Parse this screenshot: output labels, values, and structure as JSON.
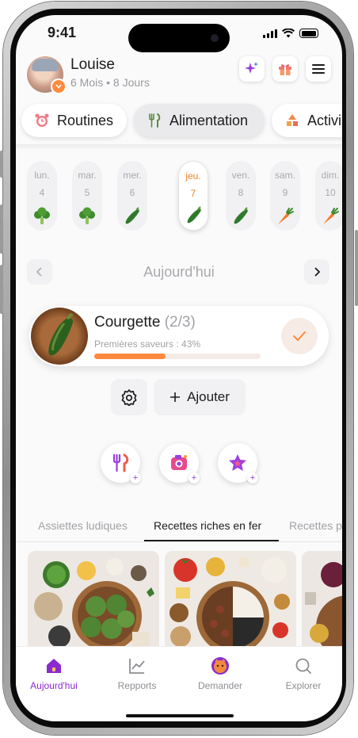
{
  "status": {
    "time": "9:41"
  },
  "profile": {
    "name": "Louise",
    "age": "6 Mois • 8 Jours"
  },
  "header_icons": [
    "sparkles-icon",
    "gift-icon",
    "menu-icon"
  ],
  "tabs": [
    {
      "label": "Routines",
      "icon": "alarm-clock-icon"
    },
    {
      "label": "Alimentation",
      "icon": "fork-knife-icon",
      "active": true
    },
    {
      "label": "Activi",
      "icon": "shapes-icon"
    }
  ],
  "days": [
    {
      "name": "lun.",
      "num": "4",
      "veg": "broccoli"
    },
    {
      "name": "mar.",
      "num": "5",
      "veg": "broccoli"
    },
    {
      "name": "mer.",
      "num": "6",
      "veg": "zucchini"
    },
    {
      "name": "jeu.",
      "num": "7",
      "veg": "zucchini",
      "today": true
    },
    {
      "name": "ven.",
      "num": "8",
      "veg": "zucchini"
    },
    {
      "name": "sam.",
      "num": "9",
      "veg": "carrot"
    },
    {
      "name": "dim.",
      "num": "10",
      "veg": "carrot"
    }
  ],
  "nav": {
    "title": "Aujourd'hui"
  },
  "food": {
    "name": "Courgette",
    "count": "(2/3)",
    "subtitle": "Premières saveurs : 43%",
    "progress": 0.43
  },
  "actions": {
    "add_label": "Ajouter"
  },
  "quick_actions": [
    "fork-knife-add-icon",
    "camera-add-icon",
    "star-add-icon"
  ],
  "recipe_tabs": [
    {
      "label": "Assiettes ludiques"
    },
    {
      "label": "Recettes riches en fer",
      "active": true
    },
    {
      "label": "Recettes p"
    }
  ],
  "bottom_nav": [
    {
      "label": "Aujourd'hui",
      "icon": "home-icon",
      "active": true
    },
    {
      "label": "Repports",
      "icon": "chart-icon"
    },
    {
      "label": "Demander",
      "icon": "assistant-avatar-icon"
    },
    {
      "label": "Explorer",
      "icon": "search-icon"
    }
  ],
  "colors": {
    "accent": "#ff8a3d",
    "nav_active": "#8b2ad0"
  }
}
